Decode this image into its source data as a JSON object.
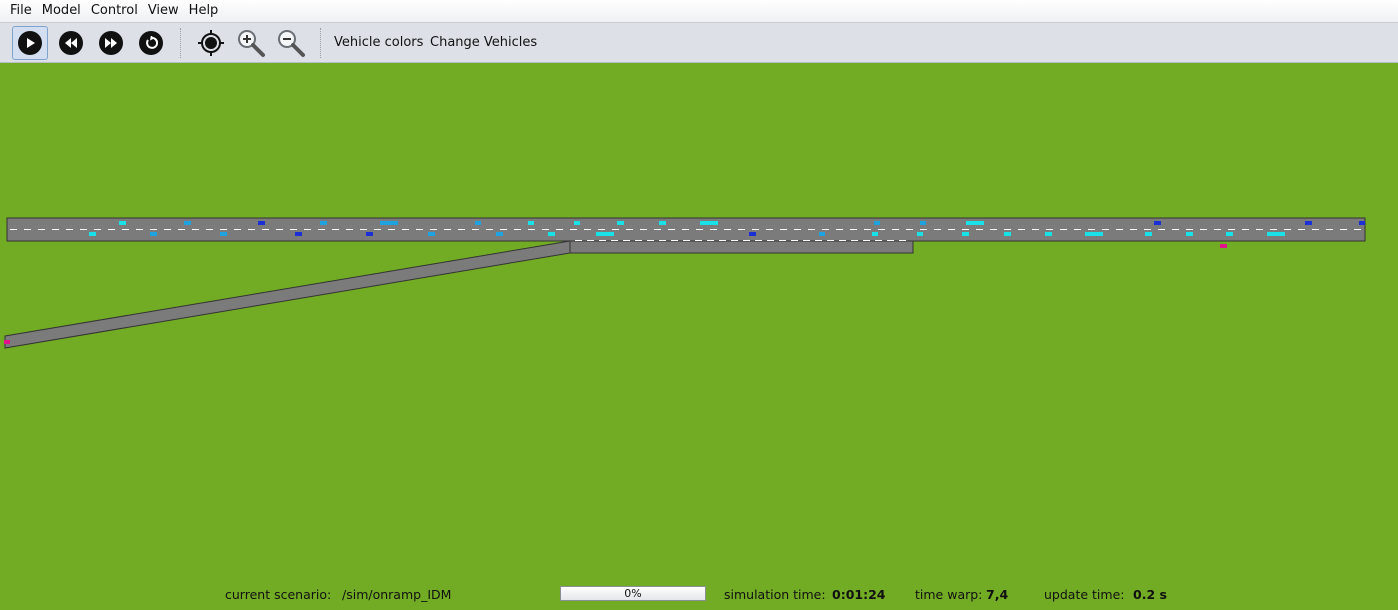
{
  "menu": {
    "items": [
      "File",
      "Model",
      "Control",
      "View",
      "Help"
    ]
  },
  "toolbar": {
    "buttons": [
      {
        "name": "play",
        "icon": "play-icon",
        "active": true
      },
      {
        "name": "rewind",
        "icon": "rewind-icon"
      },
      {
        "name": "fast-forward",
        "icon": "fast-forward-icon"
      },
      {
        "name": "reset",
        "icon": "reset-icon"
      },
      {
        "name": "center",
        "icon": "crosshair-icon"
      },
      {
        "name": "zoom-in",
        "icon": "zoom-in-icon"
      },
      {
        "name": "zoom-out",
        "icon": "zoom-out-icon"
      }
    ],
    "vehicle_colors_label": "Vehicle colors",
    "change_vehicles_label": "Change Vehicles"
  },
  "colors": {
    "grass": "#72ab24",
    "road": "#7b7b7b",
    "lane_marking": "#ffffff",
    "vehicle_light_blue": "#1fa3e0",
    "vehicle_cyan": "#19e1e8",
    "vehicle_dark_blue": "#1b2fd6",
    "vehicle_ramp": "#e0138c"
  },
  "status": {
    "scenario_label": "current scenario:",
    "scenario_value": "/sim/onramp_IDM",
    "progress_text": "0%",
    "progress_fraction": 0.0,
    "sim_time_label": "simulation time:",
    "sim_time_value": "0:01:24",
    "time_warp_label": "time warp:",
    "time_warp_value": "7,4",
    "update_time_label": "update time:",
    "update_time_value": "0.2 s"
  }
}
